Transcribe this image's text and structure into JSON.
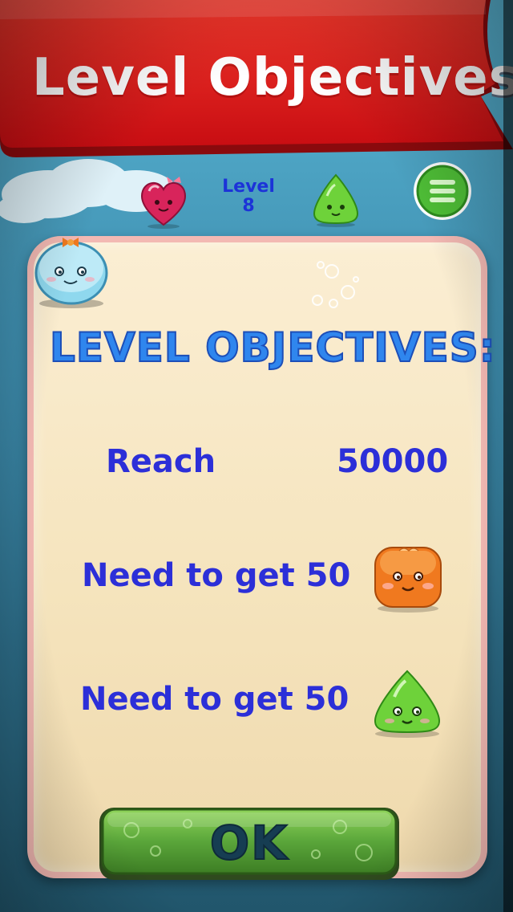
{
  "banner": {
    "title": "Level Objectives",
    "color": "#e0161d"
  },
  "status_bar": {
    "level_label": "Level",
    "level_number": "8",
    "left_icon": "pink-heart-jelly-icon",
    "right_icon": "green-drop-jelly-icon",
    "menu_icon": "green-menu-button-icon"
  },
  "panel": {
    "heading": "LEVEL OBJECTIVES:",
    "mascot_icon": "blue-jelly-mascot-icon",
    "objectives": [
      {
        "label": "Reach",
        "value": "50000"
      },
      {
        "label": "Need to get 50",
        "target_icon": "orange-jelly-icon"
      },
      {
        "label": "Need to get 50",
        "target_icon": "green-jelly-icon"
      }
    ]
  },
  "ok_button": {
    "label": "OK",
    "color": "#5aa63a"
  },
  "colors": {
    "text_blue": "#2c2fd8",
    "heading_blue": "#2f86ee",
    "panel_border": "#f3b9b3",
    "panel_fill": "#f8e8c8"
  }
}
